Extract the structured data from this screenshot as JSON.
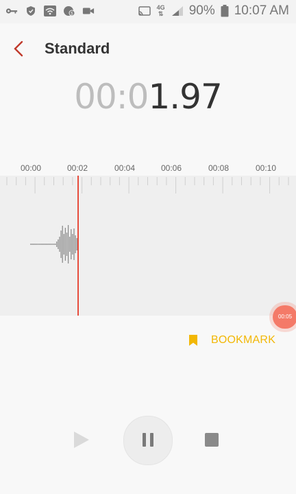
{
  "status_bar": {
    "network_label": "4G",
    "battery": "90%",
    "time": "10:07 AM",
    "icons_left": [
      "key-icon",
      "shield-icon",
      "wifi-icon",
      "data-saver-icon",
      "video-icon"
    ],
    "icons_right": [
      "cast-icon",
      "network-4g-icon",
      "signal-icon",
      "battery-icon"
    ]
  },
  "header": {
    "title": "Standard"
  },
  "timer": {
    "dim_part": "00:0",
    "bright_part": "1.97"
  },
  "timeline": {
    "labels": [
      "00:00",
      "00:02",
      "00:04",
      "00:06",
      "00:08",
      "00:10"
    ]
  },
  "bookmark_marker": {
    "time": "00:05"
  },
  "bookmark_button": {
    "label": "BOOKMARK"
  },
  "colors": {
    "accent": "#e74c3c",
    "bookmark": "#f2b705",
    "marker": "#f47a68"
  },
  "controls": {
    "play_icon": "play-icon",
    "pause_icon": "pause-icon",
    "stop_icon": "stop-icon"
  }
}
